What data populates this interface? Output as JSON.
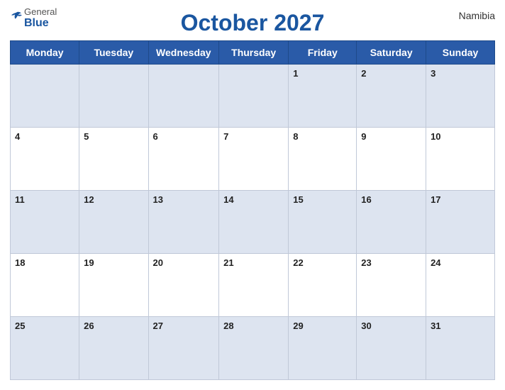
{
  "header": {
    "logo_general": "General",
    "logo_blue": "Blue",
    "title": "October 2027",
    "country": "Namibia"
  },
  "weekdays": [
    "Monday",
    "Tuesday",
    "Wednesday",
    "Thursday",
    "Friday",
    "Saturday",
    "Sunday"
  ],
  "weeks": [
    [
      null,
      null,
      null,
      null,
      1,
      2,
      3
    ],
    [
      4,
      5,
      6,
      7,
      8,
      9,
      10
    ],
    [
      11,
      12,
      13,
      14,
      15,
      16,
      17
    ],
    [
      18,
      19,
      20,
      21,
      22,
      23,
      24
    ],
    [
      25,
      26,
      27,
      28,
      29,
      30,
      31
    ]
  ]
}
